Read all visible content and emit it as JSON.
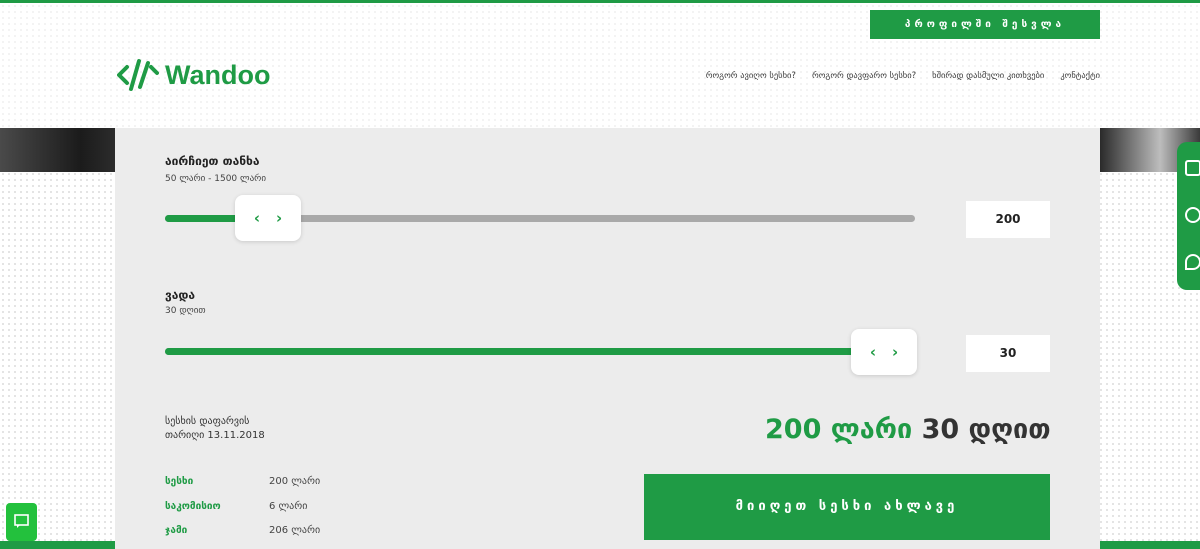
{
  "header": {
    "profile_button": "პროფილში შესვლა",
    "logo_text": "Wandoo",
    "nav": [
      "როგორ ავიღო სესხი?",
      "როგორ დავფარო სესხი?",
      "ხშირად დასმული კითხვები",
      "კონტაქტი"
    ]
  },
  "amount": {
    "title": "აირჩიეთ თანხა",
    "range": "50 ლარი - 1500 ლარი",
    "value": "200",
    "slider_fraction": 0.1034
  },
  "term": {
    "title": "ვადა",
    "range": "30 დღით",
    "value": "30",
    "slider_fraction": 1.0
  },
  "due": {
    "label": "სესხის დაფარვის",
    "date_label": "თარიღი 13.11.2018"
  },
  "summary": {
    "amount_text": "200 ლარი",
    "days_text": "30 დღით"
  },
  "details": [
    {
      "key": "სესხი",
      "value": "200 ლარი"
    },
    {
      "key": "საკომისიო",
      "value": "6 ლარი"
    },
    {
      "key": "ჯამი",
      "value": "206 ლარი"
    }
  ],
  "cta_button": "მიიღეთ სესხი ახლავე",
  "colors": {
    "brand": "#1f9b45",
    "panel": "#ececec"
  },
  "icons": [
    "logo-icon",
    "chevron-left-icon",
    "chevron-right-icon",
    "chat-icon",
    "phone-icon",
    "mail-icon",
    "location-icon"
  ]
}
